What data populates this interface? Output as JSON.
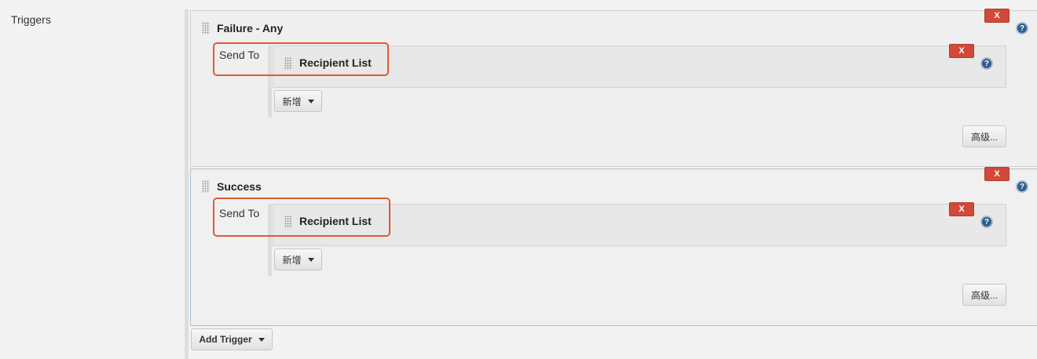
{
  "section_label": "Triggers",
  "triggers": [
    {
      "title": "Failure - Any",
      "remove_label": "X",
      "send_to_label": "Send To",
      "recipient": {
        "title": "Recipient List",
        "remove_label": "X"
      },
      "add_label": "新增",
      "advanced_label": "高级..."
    },
    {
      "title": "Success",
      "remove_label": "X",
      "send_to_label": "Send To",
      "recipient": {
        "title": "Recipient List",
        "remove_label": "X"
      },
      "add_label": "新增",
      "advanced_label": "高级..."
    }
  ],
  "add_trigger_label": "Add Trigger",
  "help_glyph": "?",
  "colors": {
    "remove_button": "#d24939",
    "highlight_border": "#e05a33",
    "help_icon": "#2f5c8a"
  }
}
